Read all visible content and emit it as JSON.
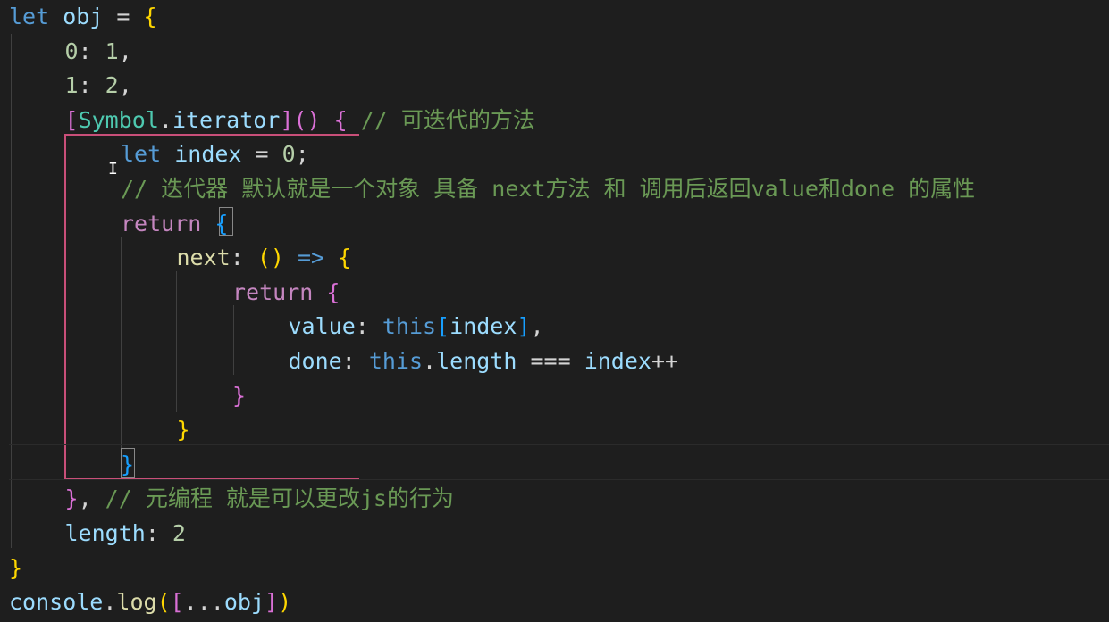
{
  "code": {
    "lines": [
      {
        "indent": 0,
        "tokens": [
          [
            "kwb",
            "let "
          ],
          [
            "var",
            "obj"
          ],
          [
            "op",
            " = "
          ],
          [
            "b1",
            "{"
          ]
        ]
      },
      {
        "indent": 1,
        "tokens": [
          [
            "num",
            "0"
          ],
          [
            "op",
            ": "
          ],
          [
            "num",
            "1"
          ],
          [
            "op",
            ","
          ]
        ]
      },
      {
        "indent": 1,
        "tokens": [
          [
            "num",
            "1"
          ],
          [
            "op",
            ": "
          ],
          [
            "num",
            "2"
          ],
          [
            "op",
            ","
          ]
        ]
      },
      {
        "indent": 1,
        "tokens": [
          [
            "b2",
            "["
          ],
          [
            "cls",
            "Symbol"
          ],
          [
            "op",
            "."
          ],
          [
            "var",
            "iterator"
          ],
          [
            "b2",
            "]"
          ],
          [
            "b2",
            "()"
          ],
          [
            "op",
            " "
          ],
          [
            "b2",
            "{"
          ],
          [
            "cmt",
            " // 可迭代的方法"
          ]
        ]
      },
      {
        "indent": 2,
        "tokens": [
          [
            "kwb",
            "let "
          ],
          [
            "var",
            "index"
          ],
          [
            "op",
            " = "
          ],
          [
            "num",
            "0"
          ],
          [
            "op",
            ";"
          ]
        ]
      },
      {
        "indent": 2,
        "tokens": [
          [
            "cmt",
            "// 迭代器 默认就是一个对象 具备 next方法 和 调用后返回value和done 的属性"
          ]
        ]
      },
      {
        "indent": 2,
        "tokens": [
          [
            "kw",
            "return "
          ],
          [
            "b3",
            "{"
          ]
        ]
      },
      {
        "indent": 3,
        "tokens": [
          [
            "fn",
            "next"
          ],
          [
            "op",
            ": "
          ],
          [
            "b1",
            "()"
          ],
          [
            "op",
            " "
          ],
          [
            "kwb",
            "=>"
          ],
          [
            "op",
            " "
          ],
          [
            "b1",
            "{"
          ]
        ]
      },
      {
        "indent": 4,
        "tokens": [
          [
            "kw",
            "return "
          ],
          [
            "b2",
            "{"
          ]
        ]
      },
      {
        "indent": 5,
        "tokens": [
          [
            "var",
            "value"
          ],
          [
            "op",
            ": "
          ],
          [
            "kwb",
            "this"
          ],
          [
            "b3",
            "["
          ],
          [
            "var",
            "index"
          ],
          [
            "b3",
            "]"
          ],
          [
            "op",
            ","
          ]
        ]
      },
      {
        "indent": 5,
        "tokens": [
          [
            "var",
            "done"
          ],
          [
            "op",
            ": "
          ],
          [
            "kwb",
            "this"
          ],
          [
            "op",
            "."
          ],
          [
            "var",
            "length"
          ],
          [
            "op",
            " === "
          ],
          [
            "var",
            "index"
          ],
          [
            "op",
            "++"
          ]
        ]
      },
      {
        "indent": 4,
        "tokens": [
          [
            "b2",
            "}"
          ]
        ]
      },
      {
        "indent": 3,
        "tokens": [
          [
            "b1",
            "}"
          ]
        ]
      },
      {
        "indent": 2,
        "tokens": [
          [
            "b3",
            "}"
          ]
        ]
      },
      {
        "indent": 1,
        "tokens": [
          [
            "b2",
            "}"
          ],
          [
            "op",
            ", "
          ],
          [
            "cmt",
            "// 元编程 就是可以更改js的行为"
          ]
        ]
      },
      {
        "indent": 1,
        "tokens": [
          [
            "var",
            "length"
          ],
          [
            "op",
            ": "
          ],
          [
            "num",
            "2"
          ]
        ]
      },
      {
        "indent": 0,
        "tokens": [
          [
            "b1",
            "}"
          ]
        ]
      },
      {
        "indent": 0,
        "tokens": [
          [
            "var",
            "console"
          ],
          [
            "op",
            "."
          ],
          [
            "fn",
            "log"
          ],
          [
            "b1",
            "("
          ],
          [
            "b2",
            "["
          ],
          [
            "op",
            "..."
          ],
          [
            "var",
            "obj"
          ],
          [
            "b2",
            "]"
          ],
          [
            "b1",
            ")"
          ]
        ]
      }
    ]
  },
  "colors": {
    "background": "#1e1e1e",
    "keyword": "#c586c0",
    "keyword_blue": "#569cd6",
    "variable": "#9cdcfe",
    "number": "#b5cea8",
    "function": "#dcdcaa",
    "comment": "#6a9955",
    "bracket_gold": "#ffd700",
    "bracket_orchid": "#da70d6",
    "bracket_blue": "#179fff",
    "class": "#4ec9b0"
  }
}
